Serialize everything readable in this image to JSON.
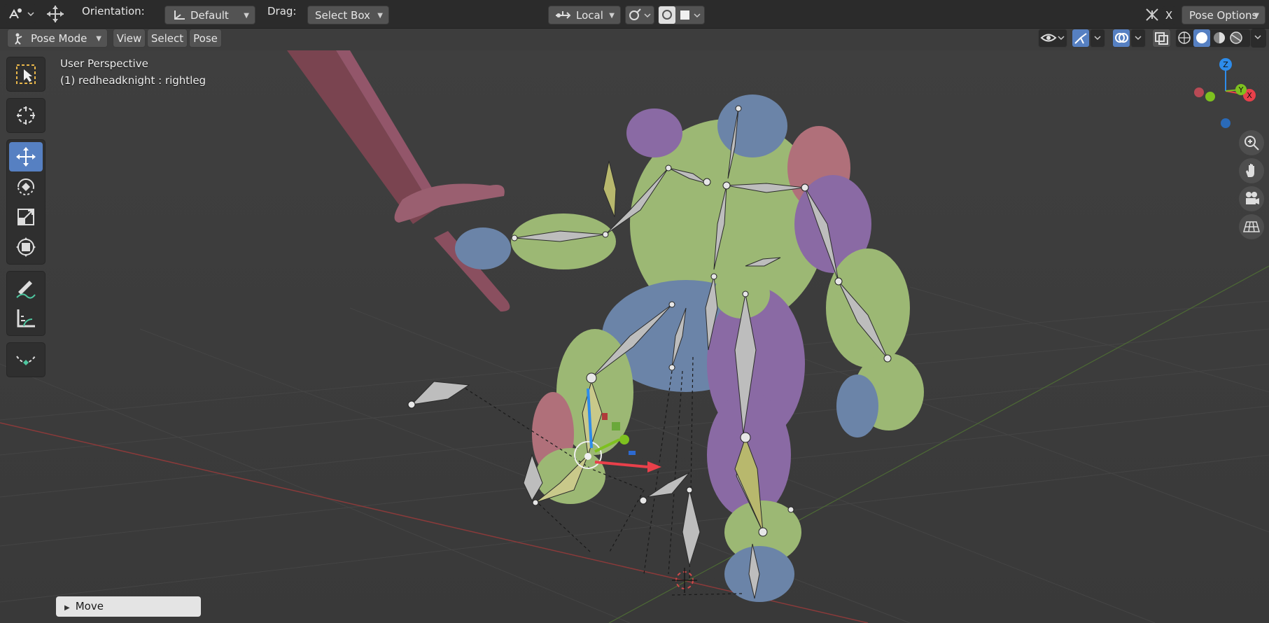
{
  "header": {
    "orientation_label": "Orientation:",
    "orientation_value": "Default",
    "drag_label": "Drag:",
    "drag_value": "Select Box",
    "pivot_value": "Local",
    "close_x": "X",
    "pose_options": "Pose Options"
  },
  "subheader": {
    "mode": "Pose Mode",
    "menus": [
      "View",
      "Select",
      "Pose"
    ]
  },
  "viewport": {
    "view_name": "User Perspective",
    "object_info": "(1) redheadknight : rightleg"
  },
  "gizmo": {
    "x": "X",
    "y": "Y",
    "z": "Z"
  },
  "operator_panel": {
    "title": "Move"
  },
  "colors": {
    "active_blue": "#5680c2",
    "axis_x": "#e8404a",
    "axis_y": "#7ec11f",
    "axis_z": "#2d8ceb",
    "mesh_green": "#9cb874",
    "mesh_purple": "#8a6aa4",
    "mesh_blue": "#6b84a8",
    "mesh_red": "#b0707a"
  },
  "icons": [
    "editor-type-icon",
    "move-gizmo-icon",
    "orientation-icon",
    "pivot-icon",
    "snap-icon",
    "proportional-icon",
    "visibility-icon",
    "gizmo-icon",
    "overlay-icon",
    "xray-icon",
    "wireframe-shading-icon",
    "solid-shading-icon",
    "material-shading-icon",
    "rendered-shading-icon",
    "select-box-tool-icon",
    "cursor-tool-icon",
    "move-tool-icon",
    "rotate-tool-icon",
    "scale-tool-icon",
    "transform-tool-icon",
    "annotate-tool-icon",
    "measure-tool-icon",
    "relax-tool-icon",
    "zoom-icon",
    "hand-icon",
    "camera-icon",
    "grid-icon"
  ]
}
